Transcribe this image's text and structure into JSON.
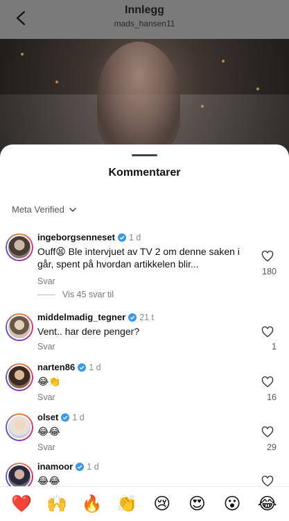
{
  "header": {
    "title": "Innlegg",
    "subtitle": "mads_hansen11"
  },
  "sheet": {
    "title": "Kommentarer",
    "filter_label": "Meta Verified"
  },
  "comments": [
    {
      "username": "ingeborgsenneset",
      "verified": true,
      "time": "1 d",
      "text": "Ouff😫 Ble intervjuet av TV 2 om denne saken i går, spent på hvordan artikkelen blir...",
      "reply_label": "Svar",
      "likes": "180",
      "more_replies": "Vis 45 svar til"
    },
    {
      "username": "middelmadig_tegner",
      "verified": true,
      "time": "21 t",
      "text": "Vent.. har dere penger?",
      "reply_label": "Svar",
      "likes": "1"
    },
    {
      "username": "narten86",
      "verified": true,
      "time": "1 d",
      "text": "😂👏",
      "reply_label": "Svar",
      "likes": "16"
    },
    {
      "username": "olset",
      "verified": true,
      "time": "1 d",
      "text": "😂😂",
      "reply_label": "Svar",
      "likes": "29"
    },
    {
      "username": "inamoor",
      "verified": true,
      "time": "1 d",
      "text": "😂😂",
      "reply_label": "",
      "likes": ""
    }
  ],
  "emoji_bar": [
    "❤️",
    "🙌",
    "🔥",
    "👏",
    "😢",
    "😍",
    "😮",
    "😂"
  ],
  "colors": {
    "verified_badge": "#3897f0",
    "avatar_ring_start": "#f58529",
    "avatar_ring_end": "#515bd4"
  }
}
